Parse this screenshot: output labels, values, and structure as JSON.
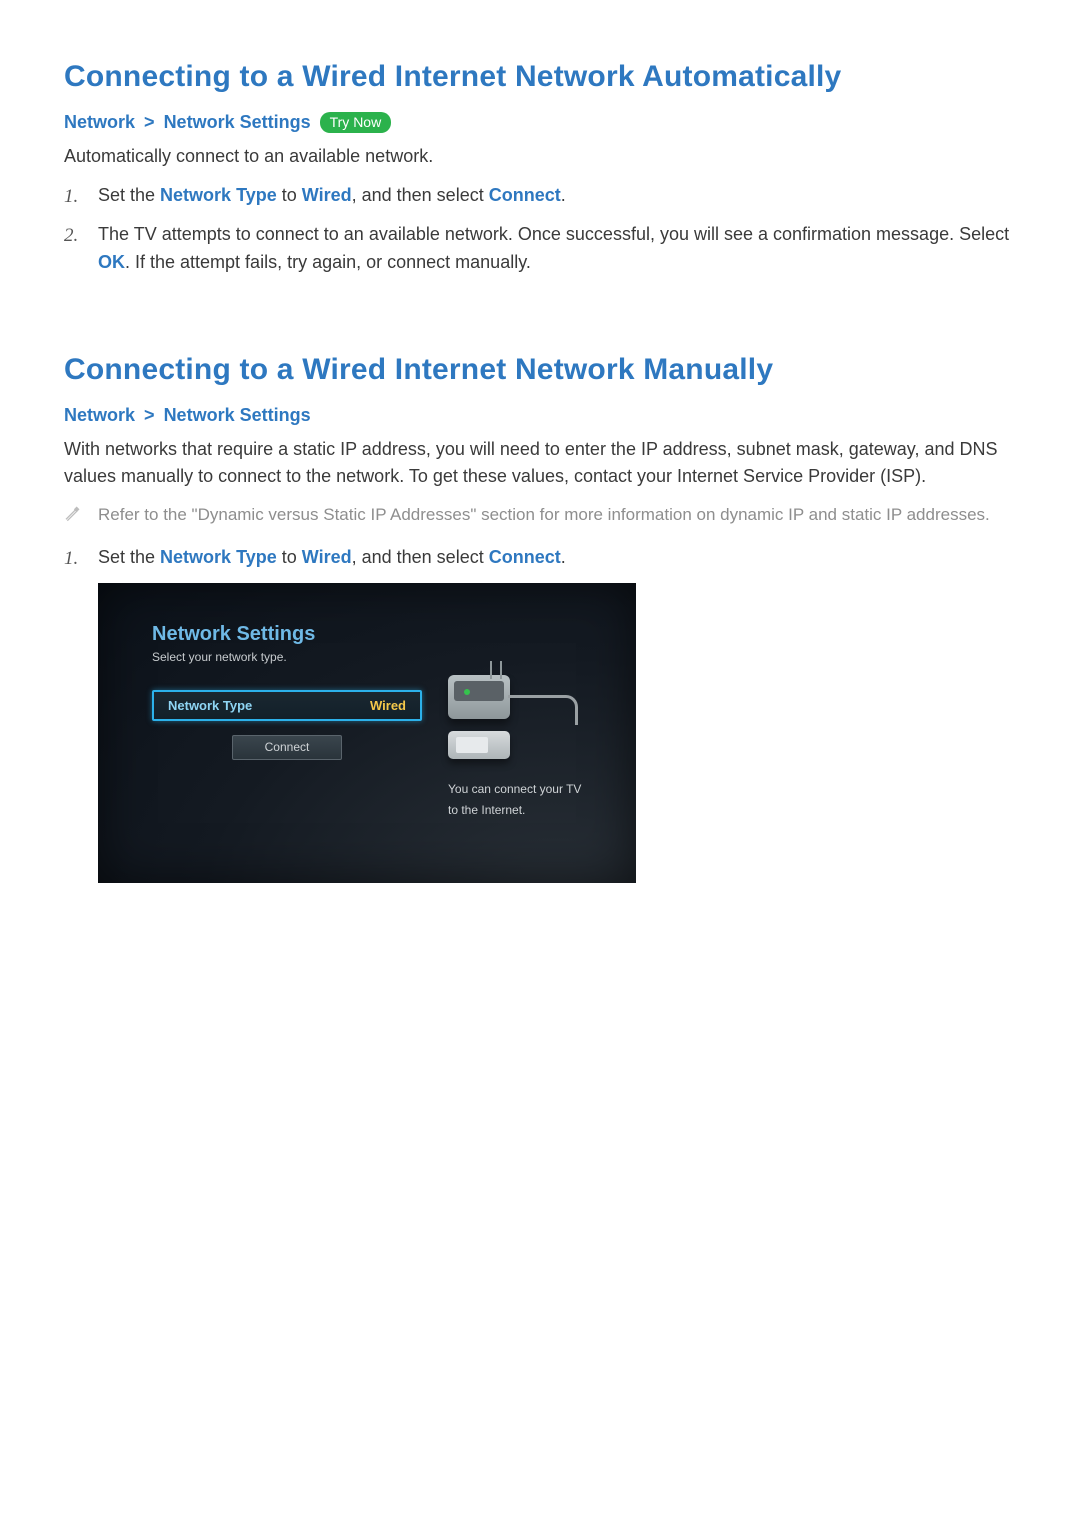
{
  "section1": {
    "title": "Connecting to a Wired Internet Network Automatically",
    "breadcrumb": {
      "a": "Network",
      "b": "Network Settings",
      "try_now": "Try Now"
    },
    "intro": "Automatically connect to an available network.",
    "steps": [
      {
        "num": "1.",
        "pre": "Set the ",
        "h1": "Network Type",
        "mid1": " to ",
        "h2": "Wired",
        "mid2": ", and then select ",
        "h3": "Connect",
        "post": "."
      },
      {
        "num": "2.",
        "pre": "The TV attempts to connect to an available network. Once successful, you will see a confirmation message. Select ",
        "h1": "OK",
        "post": ". If the attempt fails, try again, or connect manually."
      }
    ]
  },
  "section2": {
    "title": "Connecting to a Wired Internet Network Manually",
    "breadcrumb": {
      "a": "Network",
      "b": "Network Settings"
    },
    "intro": "With networks that require a static IP address, you will need to enter the IP address, subnet mask, gateway, and DNS values manually to connect to the network. To get these values, contact your Internet Service Provider (ISP).",
    "note": "Refer to the \"Dynamic versus Static IP Addresses\" section for more information on dynamic IP and static IP addresses.",
    "steps": [
      {
        "num": "1.",
        "pre": "Set the ",
        "h1": "Network Type",
        "mid1": " to ",
        "h2": "Wired",
        "mid2": ", and then select ",
        "h3": "Connect",
        "post": "."
      }
    ]
  },
  "tv": {
    "title": "Network Settings",
    "subtitle": "Select your network type.",
    "network_type_label": "Network Type",
    "network_type_value": "Wired",
    "connect_label": "Connect",
    "msg_line1": "You can connect your TV",
    "msg_line2": "to the Internet."
  }
}
